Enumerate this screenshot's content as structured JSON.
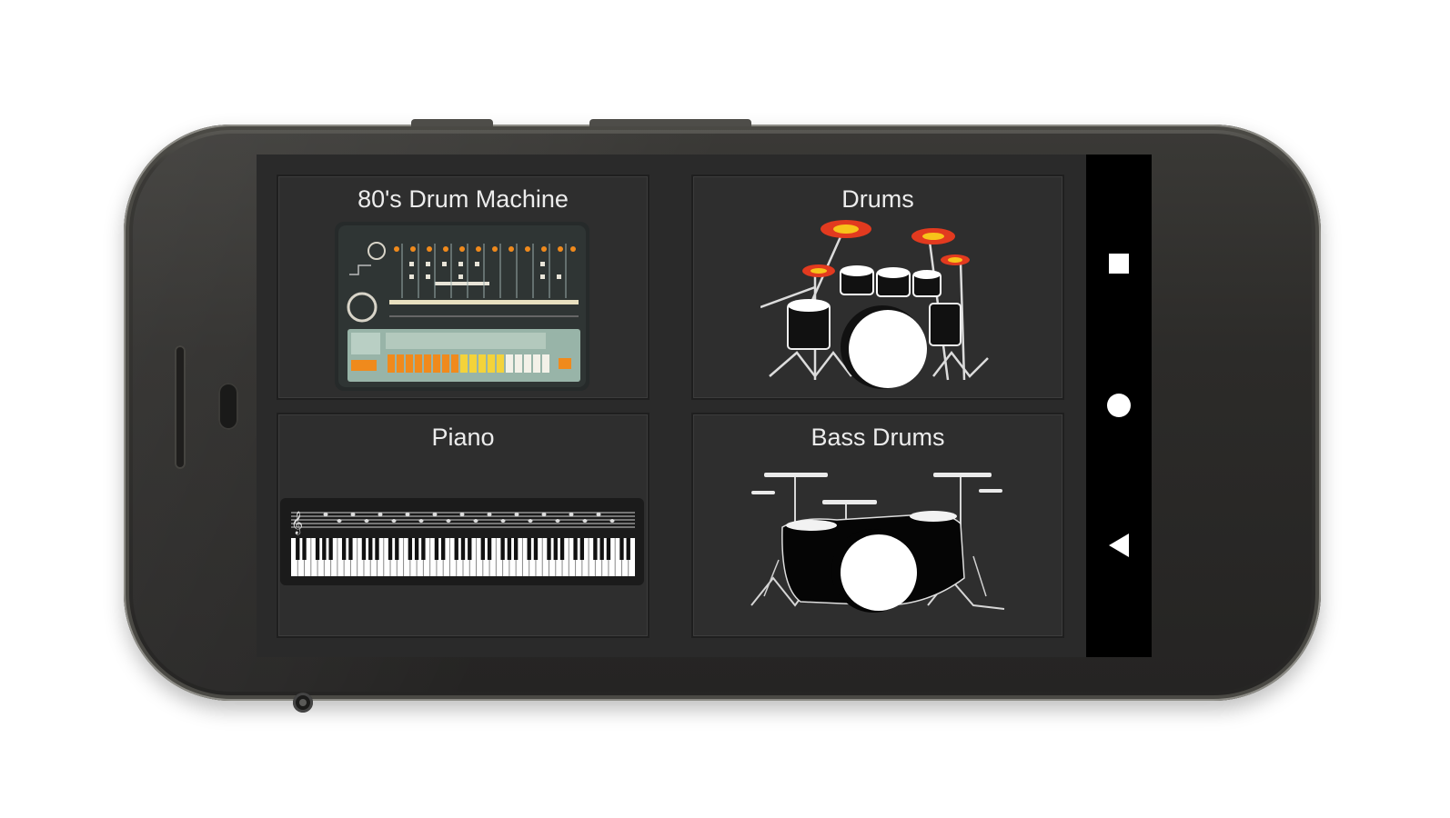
{
  "apps": {
    "tiles": [
      {
        "label": "80's Drum Machine",
        "icon": "drum-machine-icon"
      },
      {
        "label": "Drums",
        "icon": "drum-kit-icon"
      },
      {
        "label": "Piano",
        "icon": "piano-keyboard-icon"
      },
      {
        "label": "Bass Drums",
        "icon": "bass-drum-kit-icon"
      }
    ]
  },
  "navigation_bar": {
    "recents_icon": "square-icon",
    "home_icon": "circle-icon",
    "back_icon": "triangle-icon"
  },
  "colors": {
    "tile_background": "#2e2e2e",
    "screen_background": "#2a2a2a",
    "nav_bar": "#000000",
    "cymbal_red": "#e23a1f",
    "cymbal_yellow": "#f7c31a",
    "machine_orange": "#f08a1c"
  }
}
